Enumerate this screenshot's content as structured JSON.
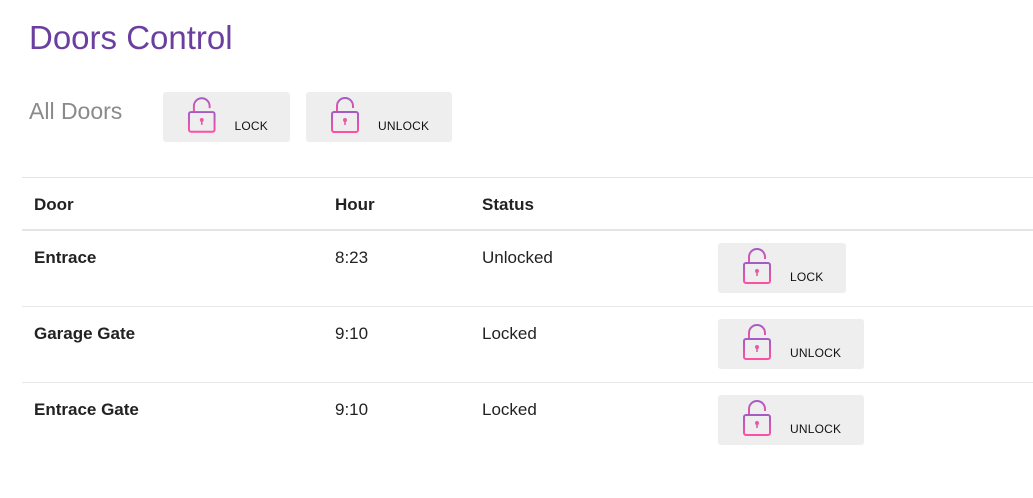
{
  "header": {
    "title": "Doors Control"
  },
  "all_doors": {
    "label": "All Doors",
    "lock_label": "LOCK",
    "unlock_label": "UNLOCK"
  },
  "table": {
    "columns": [
      "Door",
      "Hour",
      "Status"
    ],
    "rows": [
      {
        "door": "Entrace",
        "hour": "8:23",
        "status": "Unlocked",
        "action": "LOCK"
      },
      {
        "door": "Garage Gate",
        "hour": "9:10",
        "status": "Locked",
        "action": "UNLOCK"
      },
      {
        "door": "Entrace Gate",
        "hour": "9:10",
        "status": "Locked",
        "action": "UNLOCK"
      }
    ]
  },
  "icons": {
    "lock_button_icon": "padlock-icon",
    "unlock_button_icon": "padlock-icon"
  },
  "colors": {
    "title": "#6b3fa0",
    "icon_gradient_top": "#9b59b6",
    "icon_gradient_bottom": "#ff4fa3",
    "button_bg": "#eeeeee"
  }
}
